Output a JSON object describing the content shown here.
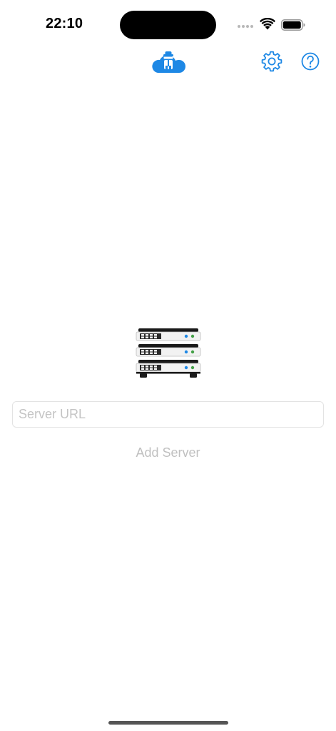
{
  "status_bar": {
    "time": "22:10",
    "icons": [
      "signal-dots-icon",
      "wifi-icon",
      "battery-icon"
    ]
  },
  "nav_bar": {
    "logo_icon": "cloud-agent-icon",
    "settings_icon": "gear-icon",
    "help_icon": "question-circle-icon"
  },
  "main": {
    "illustration_icon": "server-rack-icon",
    "server_url": {
      "placeholder": "Server URL",
      "value": ""
    },
    "add_server_label": "Add Server"
  },
  "colors": {
    "accent": "#1e88e5",
    "placeholder": "#c4c4c4",
    "disabled_text": "#c0c0c0",
    "field_border": "#e3e3e3"
  }
}
